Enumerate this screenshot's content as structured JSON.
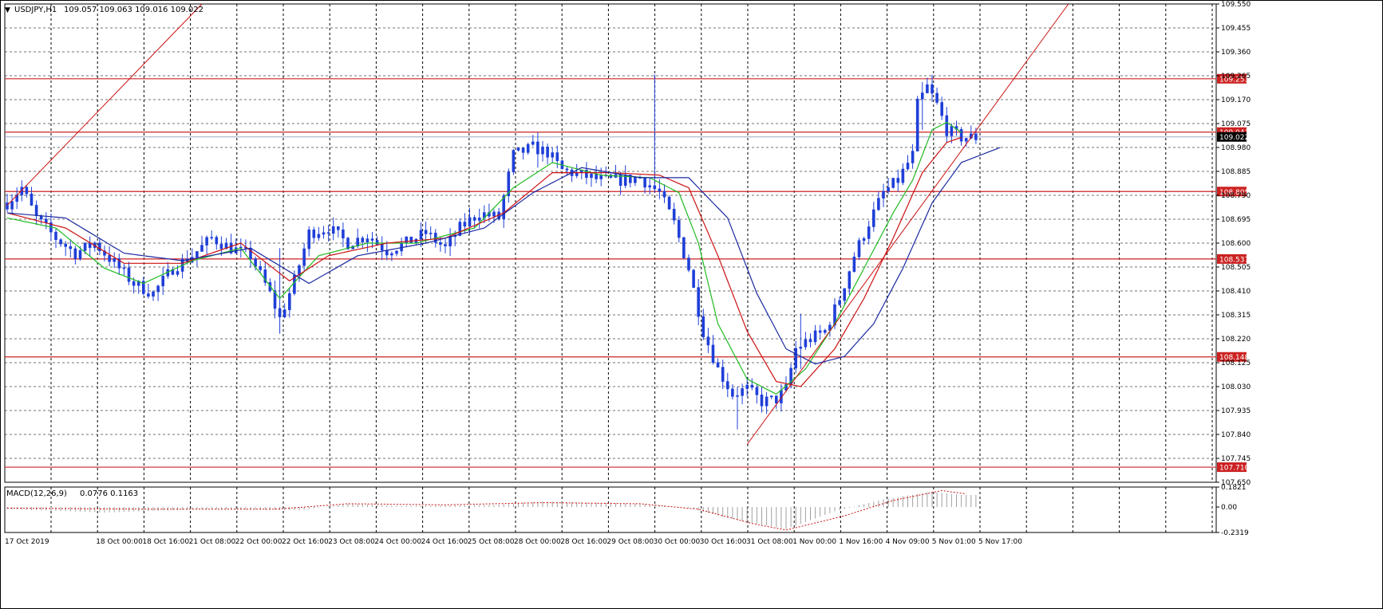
{
  "header": {
    "symbol": "USDJPY,H1",
    "ohlc": "109.057 109.063 109.016 109.022"
  },
  "macd_header": {
    "label": "MACD(12,26,9)",
    "values": "0.0776 0.1163"
  },
  "colors": {
    "background": "#ffffff",
    "grid": "#000000",
    "candle": "#1f3fd8",
    "ma_fast": "#22bb22",
    "ma_mid": "#cc1111",
    "ma_slow": "#1a2aa0",
    "level_line": "#cc2222",
    "trend_line": "#cc1111",
    "current_price_line": "#9aa8c8",
    "macd_hist": "#a0a0a0",
    "macd_signal": "#cc1111"
  },
  "chart_data": {
    "type": "candlestick",
    "title": "USDJPY,H1",
    "ylim": [
      107.65,
      109.55
    ],
    "y_ticks": [
      "109.550",
      "109.455",
      "109.360",
      "109.265",
      "109.170",
      "109.075",
      "108.980",
      "108.885",
      "108.790",
      "108.695",
      "108.600",
      "108.505",
      "108.410",
      "108.315",
      "108.220",
      "108.125",
      "108.030",
      "107.935",
      "107.840",
      "107.745",
      "107.650"
    ],
    "x_ticks": [
      "17 Oct 2019",
      "18 Oct 00:00",
      "18 Oct 16:00",
      "21 Oct 08:00",
      "22 Oct 00:00",
      "22 Oct 16:00",
      "23 Oct 08:00",
      "24 Oct 00:00",
      "24 Oct 16:00",
      "25 Oct 08:00",
      "28 Oct 00:00",
      "28 Oct 16:00",
      "29 Oct 08:00",
      "30 Oct 00:00",
      "30 Oct 16:00",
      "31 Oct 08:00",
      "1 Nov 00:00",
      "1 Nov 16:00",
      "4 Nov 09:00",
      "5 Nov 01:00",
      "5 Nov 17:00"
    ],
    "bars_visible": 200,
    "price_keypoints": [
      [
        0,
        108.76
      ],
      [
        3,
        108.82
      ],
      [
        6,
        108.7
      ],
      [
        10,
        108.62
      ],
      [
        14,
        108.56
      ],
      [
        18,
        108.6
      ],
      [
        22,
        108.52
      ],
      [
        26,
        108.44
      ],
      [
        30,
        108.4
      ],
      [
        34,
        108.5
      ],
      [
        38,
        108.55
      ],
      [
        42,
        108.62
      ],
      [
        46,
        108.58
      ],
      [
        50,
        108.55
      ],
      [
        54,
        108.4
      ],
      [
        56,
        108.3
      ],
      [
        59,
        108.45
      ],
      [
        62,
        108.64
      ],
      [
        66,
        108.66
      ],
      [
        70,
        108.6
      ],
      [
        74,
        108.63
      ],
      [
        78,
        108.57
      ],
      [
        82,
        108.6
      ],
      [
        86,
        108.64
      ],
      [
        90,
        108.58
      ],
      [
        93,
        108.66
      ],
      [
        97,
        108.72
      ],
      [
        101,
        108.7
      ],
      [
        104,
        108.95
      ],
      [
        108,
        108.98
      ],
      [
        111,
        108.96
      ],
      [
        114,
        108.89
      ],
      [
        118,
        108.87
      ],
      [
        122,
        108.85
      ],
      [
        126,
        108.85
      ],
      [
        130,
        108.86
      ],
      [
        134,
        108.8
      ],
      [
        137,
        108.68
      ],
      [
        140,
        108.5
      ],
      [
        143,
        108.25
      ],
      [
        146,
        108.1
      ],
      [
        149,
        108.0
      ],
      [
        152,
        108.02
      ],
      [
        155,
        107.97
      ],
      [
        158,
        107.98
      ],
      [
        160,
        108.02
      ],
      [
        162,
        108.18
      ],
      [
        165,
        108.22
      ],
      [
        168,
        108.25
      ],
      [
        171,
        108.38
      ],
      [
        174,
        108.55
      ],
      [
        177,
        108.68
      ],
      [
        180,
        108.8
      ],
      [
        183,
        108.85
      ],
      [
        186,
        108.95
      ],
      [
        187,
        109.15
      ],
      [
        189,
        109.22
      ],
      [
        191,
        109.15
      ],
      [
        193,
        109.05
      ],
      [
        196,
        109.02
      ]
    ],
    "spikes": [
      [
        133,
        109.27,
        108.85
      ],
      [
        109,
        109.04,
        108.9
      ],
      [
        56,
        108.58,
        108.24
      ],
      [
        150,
        108.02,
        107.86
      ],
      [
        163,
        108.32,
        108.1
      ],
      [
        188,
        109.24,
        109.05
      ]
    ],
    "ma_fast": [
      [
        0,
        108.7
      ],
      [
        10,
        108.66
      ],
      [
        20,
        108.5
      ],
      [
        28,
        108.44
      ],
      [
        38,
        108.53
      ],
      [
        48,
        108.58
      ],
      [
        56,
        108.38
      ],
      [
        64,
        108.55
      ],
      [
        74,
        108.6
      ],
      [
        84,
        108.6
      ],
      [
        96,
        108.66
      ],
      [
        104,
        108.82
      ],
      [
        112,
        108.92
      ],
      [
        122,
        108.87
      ],
      [
        132,
        108.86
      ],
      [
        138,
        108.8
      ],
      [
        142,
        108.6
      ],
      [
        146,
        108.28
      ],
      [
        152,
        108.06
      ],
      [
        158,
        108.0
      ],
      [
        164,
        108.1
      ],
      [
        170,
        108.28
      ],
      [
        176,
        108.5
      ],
      [
        182,
        108.72
      ],
      [
        186,
        108.85
      ],
      [
        190,
        109.05
      ],
      [
        193,
        109.08
      ],
      [
        196,
        109.04
      ]
    ],
    "ma_mid": [
      [
        0,
        108.72
      ],
      [
        12,
        108.66
      ],
      [
        24,
        108.52
      ],
      [
        36,
        108.52
      ],
      [
        48,
        108.6
      ],
      [
        58,
        108.45
      ],
      [
        66,
        108.55
      ],
      [
        78,
        108.6
      ],
      [
        90,
        108.62
      ],
      [
        102,
        108.72
      ],
      [
        112,
        108.88
      ],
      [
        124,
        108.88
      ],
      [
        134,
        108.87
      ],
      [
        140,
        108.82
      ],
      [
        146,
        108.55
      ],
      [
        152,
        108.25
      ],
      [
        158,
        108.05
      ],
      [
        163,
        108.03
      ],
      [
        170,
        108.18
      ],
      [
        176,
        108.38
      ],
      [
        182,
        108.62
      ],
      [
        188,
        108.88
      ],
      [
        193,
        109.0
      ],
      [
        196,
        109.02
      ]
    ],
    "ma_slow": [
      [
        0,
        108.72
      ],
      [
        12,
        108.7
      ],
      [
        24,
        108.56
      ],
      [
        36,
        108.53
      ],
      [
        50,
        108.58
      ],
      [
        62,
        108.44
      ],
      [
        72,
        108.55
      ],
      [
        86,
        108.6
      ],
      [
        98,
        108.66
      ],
      [
        108,
        108.8
      ],
      [
        118,
        108.9
      ],
      [
        130,
        108.86
      ],
      [
        140,
        108.86
      ],
      [
        148,
        108.7
      ],
      [
        154,
        108.4
      ],
      [
        160,
        108.18
      ],
      [
        166,
        108.12
      ],
      [
        172,
        108.15
      ],
      [
        178,
        108.28
      ],
      [
        184,
        108.5
      ],
      [
        190,
        108.76
      ],
      [
        196,
        108.92
      ],
      [
        204,
        108.98
      ]
    ],
    "levels": [
      109.253,
      109.041,
      108.805,
      108.537,
      108.148,
      107.71
    ],
    "current_price": 109.022,
    "trend_lines": [
      [
        [
          0,
          108.75
        ],
        [
          40,
          109.55
        ]
      ],
      [
        [
          152,
          107.8
        ],
        [
          218,
          109.55
        ]
      ]
    ],
    "macd": {
      "ylim": [
        -0.2319,
        0.1821
      ],
      "y_ticks": [
        "0.1821",
        "0.00",
        "-0.2319"
      ],
      "hist_keypoints": [
        [
          0,
          -0.02
        ],
        [
          20,
          -0.05
        ],
        [
          40,
          -0.02
        ],
        [
          60,
          -0.03
        ],
        [
          70,
          0.03
        ],
        [
          80,
          0.01
        ],
        [
          100,
          0.02
        ],
        [
          110,
          0.05
        ],
        [
          130,
          0.03
        ],
        [
          140,
          -0.01
        ],
        [
          150,
          -0.12
        ],
        [
          160,
          -0.2
        ],
        [
          170,
          -0.04
        ],
        [
          180,
          0.07
        ],
        [
          190,
          0.14
        ],
        [
          196,
          0.11
        ]
      ],
      "signal_keypoints": [
        [
          0,
          -0.01
        ],
        [
          30,
          -0.02
        ],
        [
          55,
          -0.02
        ],
        [
          70,
          0.03
        ],
        [
          90,
          0.02
        ],
        [
          110,
          0.04
        ],
        [
          130,
          0.03
        ],
        [
          142,
          -0.02
        ],
        [
          153,
          -0.15
        ],
        [
          160,
          -0.21
        ],
        [
          172,
          -0.08
        ],
        [
          182,
          0.06
        ],
        [
          192,
          0.15
        ],
        [
          197,
          0.12
        ]
      ]
    }
  }
}
